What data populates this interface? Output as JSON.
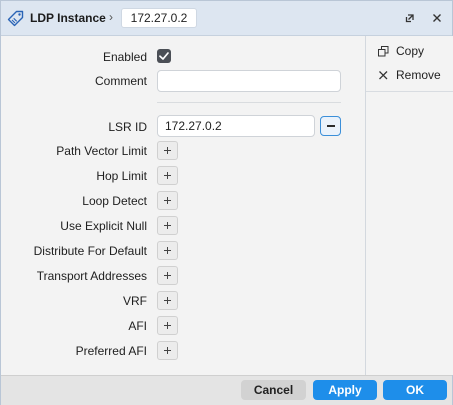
{
  "window": {
    "title": "LDP Instance",
    "breadcrumb_separator": "›",
    "instance_id": "172.27.0.2"
  },
  "side_panel": {
    "copy_label": "Copy",
    "remove_label": "Remove"
  },
  "form": {
    "enabled": {
      "label": "Enabled",
      "checked": true
    },
    "comment": {
      "label": "Comment",
      "value": "",
      "placeholder": ""
    },
    "lsr_id": {
      "label": "LSR ID",
      "value": "172.27.0.2"
    },
    "expandable": [
      {
        "label": "Path Vector Limit"
      },
      {
        "label": "Hop Limit"
      },
      {
        "label": "Loop Detect"
      },
      {
        "label": "Use Explicit Null"
      },
      {
        "label": "Distribute For Default"
      },
      {
        "label": "Transport Addresses"
      },
      {
        "label": "VRF"
      },
      {
        "label": "AFI"
      },
      {
        "label": "Preferred AFI"
      }
    ]
  },
  "footer": {
    "cancel_label": "Cancel",
    "apply_label": "Apply",
    "ok_label": "OK"
  },
  "colors": {
    "accent": "#1e8eea",
    "titlebar": "#dde6f1",
    "panel": "#f3f3f3"
  }
}
